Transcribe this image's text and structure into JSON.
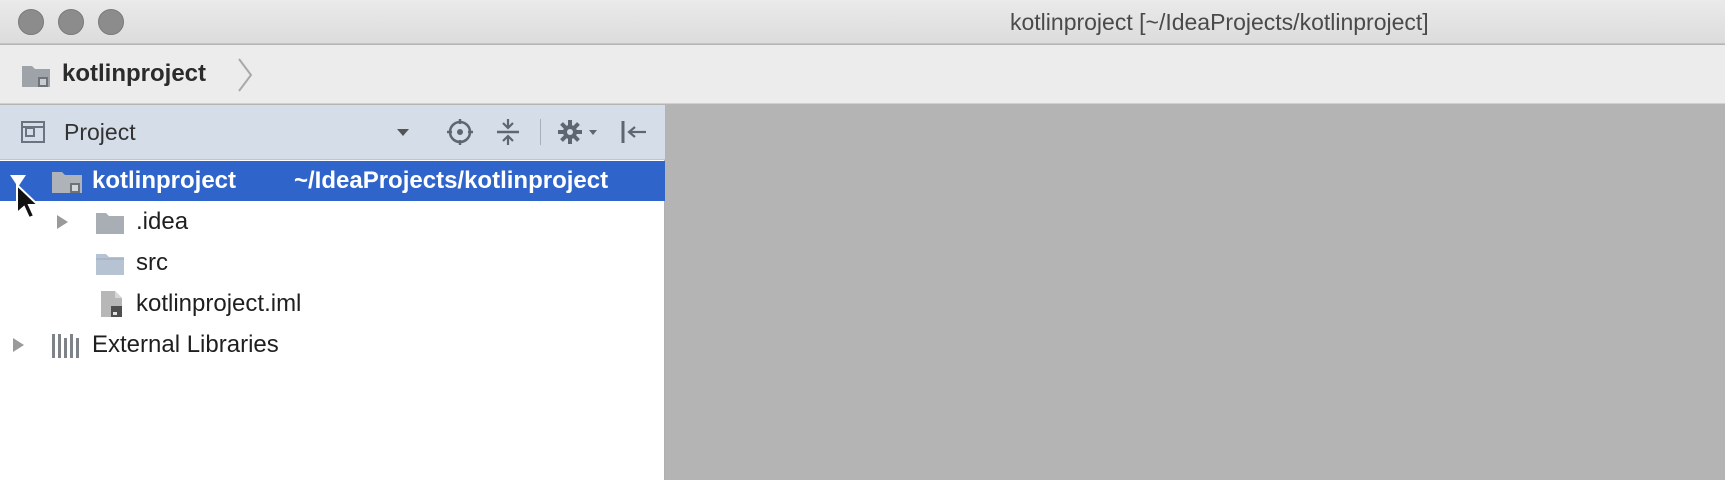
{
  "window": {
    "title": "kotlinproject [~/IdeaProjects/kotlinproject]"
  },
  "navigation_bar": {
    "breadcrumb": "kotlinproject",
    "icon": "project-folder-icon"
  },
  "project_panel": {
    "header": {
      "title": "Project",
      "icons": [
        "project-view-icon",
        "dropdown-arrow-icon",
        "locate-target-icon",
        "collapse-all-icon",
        "gear-icon",
        "hide-panel-icon"
      ]
    },
    "tree": [
      {
        "label": "kotlinproject",
        "path": "~/IdeaProjects/kotlinproject",
        "expanded": true,
        "selected": true,
        "icon": "project-folder-icon"
      },
      {
        "label": ".idea",
        "expanded": false,
        "icon": "folder-icon"
      },
      {
        "label": "src",
        "icon": "source-folder-icon"
      },
      {
        "label": "kotlinproject.iml",
        "icon": "iml-file-icon"
      },
      {
        "label": "External Libraries",
        "expanded": false,
        "icon": "library-icon"
      }
    ]
  },
  "colors": {
    "selection": "#2f65ca",
    "panel_header": "#d5dde9",
    "editor_background": "#b4b4b4"
  }
}
